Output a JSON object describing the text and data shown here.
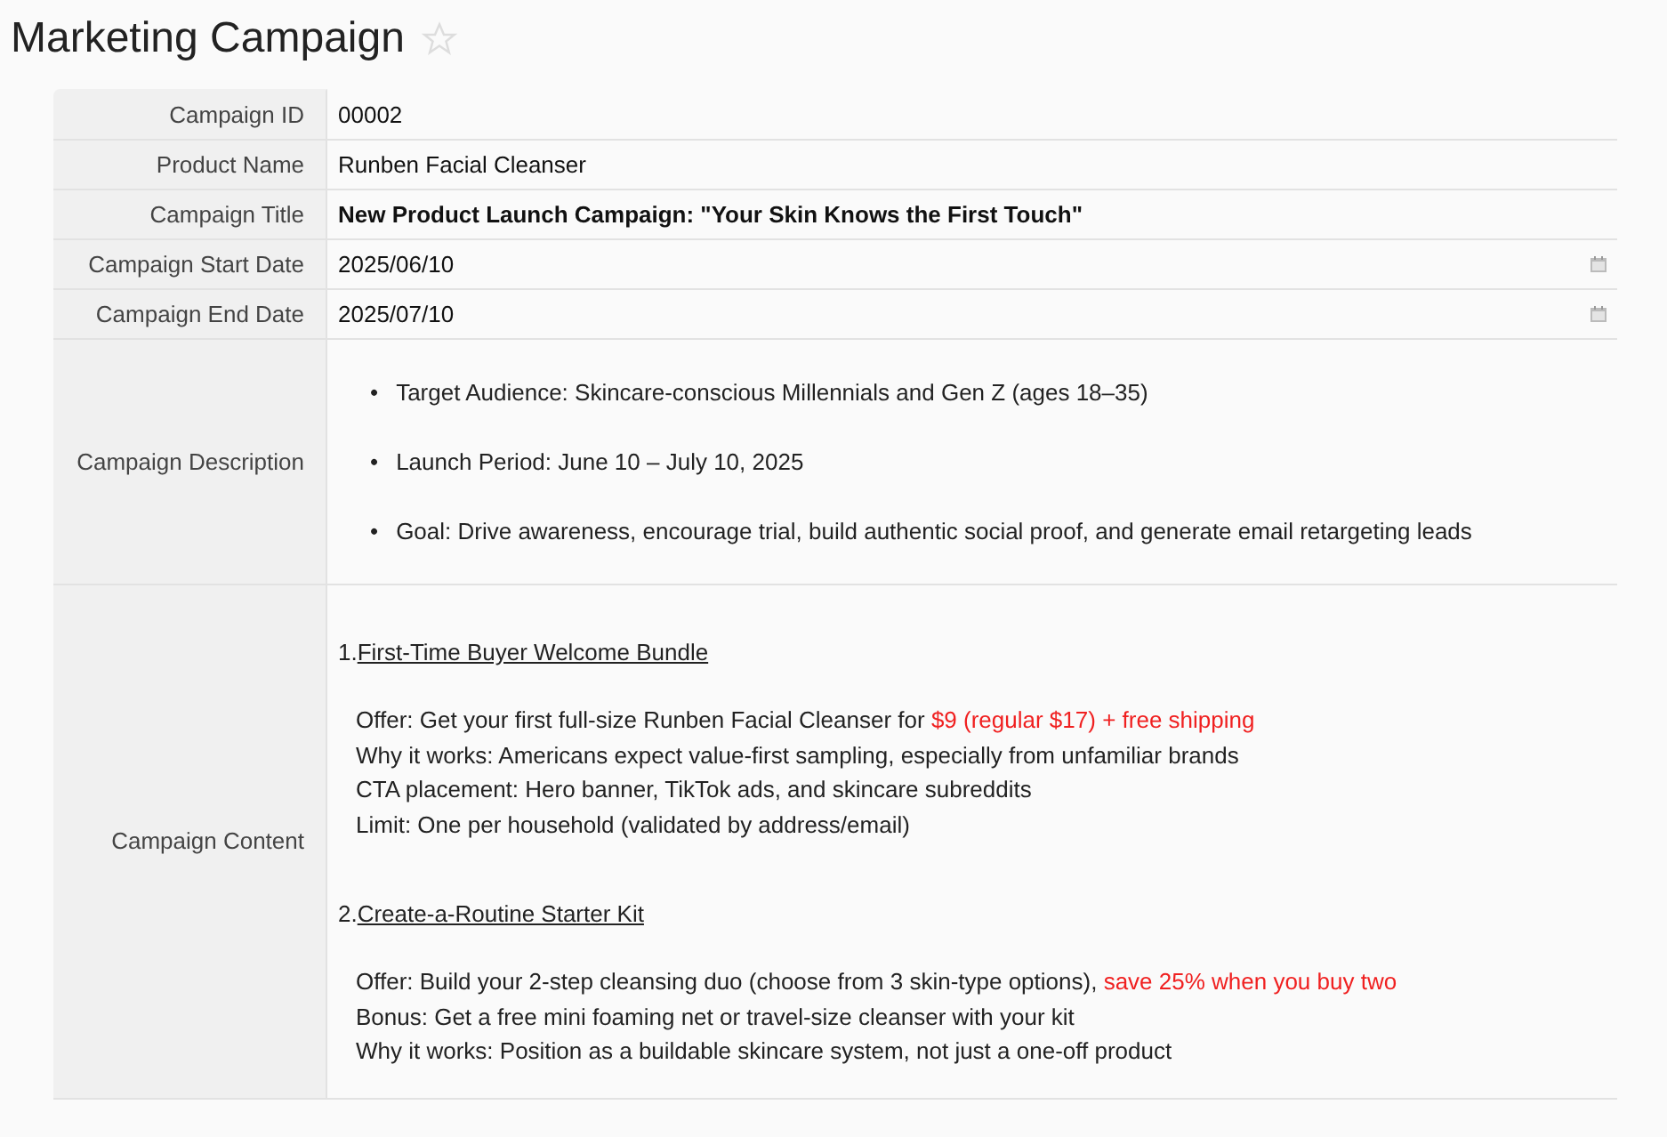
{
  "page": {
    "title": "Marketing Campaign",
    "favorite": false
  },
  "fields": [
    {
      "label": "Campaign ID",
      "kind": "text",
      "value": "00002"
    },
    {
      "label": "Product Name",
      "kind": "text",
      "value": "Runben Facial Cleanser"
    },
    {
      "label": "Campaign Title",
      "kind": "bold",
      "value": "New Product Launch Campaign: \"Your Skin Knows the First Touch\""
    },
    {
      "label": "Campaign Start Date",
      "kind": "date",
      "value": "2025/06/10"
    },
    {
      "label": "Campaign End Date",
      "kind": "date",
      "value": "2025/07/10"
    },
    {
      "label": "Campaign Description",
      "kind": "bullets",
      "items": [
        {
          "marker": "•",
          "text": "Target Audience: Skincare-conscious Millennials and Gen Z (ages 18–35)"
        },
        {
          "marker": "•",
          "text": "Launch Period: June 10 – July 10, 2025"
        },
        {
          "marker": "•",
          "text": "Goal: Drive awareness, encourage trial, build authentic social proof, and generate email retargeting leads"
        }
      ]
    },
    {
      "label": "Campaign Content",
      "kind": "sections",
      "sections": [
        {
          "number": "1.",
          "heading": "First-Time Buyer Welcome Bundle",
          "lines": [
            {
              "text": "Offer: Get your first full-size Runben Facial Cleanser for ",
              "highlight": "$9 (regular $17) + free shipping"
            },
            {
              "text": "Why it works: Americans expect value-first sampling, especially from unfamiliar brands"
            },
            {
              "text": "CTA placement: Hero banner, TikTok ads, and skincare subreddits"
            },
            {
              "text": "Limit: One per household (validated by address/email)"
            }
          ]
        },
        {
          "number": "2.",
          "heading": "Create-a-Routine Starter Kit",
          "lines": [
            {
              "text": "Offer: Build your 2-step cleansing duo (choose from 3 skin-type options), ",
              "highlight": "save 25% when you buy two"
            },
            {
              "text": "Bonus: Get a free mini foaming net or travel-size cleanser with your kit"
            },
            {
              "text": "Why it works: Position as a buildable skincare system, not just a one-off product"
            }
          ]
        }
      ]
    }
  ]
}
